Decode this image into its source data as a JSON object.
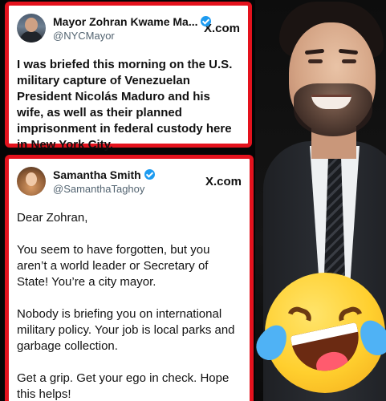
{
  "tweet1": {
    "name": "Mayor Zohran Kwame Ma...",
    "handle": "@NYCMayor",
    "source": "X.com",
    "text": "I was briefed this morning on the U.S. military capture of Venezuelan President Nicolás Maduro and his wife, as well as their planned imprisonment in federal custody here in New York City."
  },
  "tweet2": {
    "name": "Samantha Smith",
    "handle": "@SamanthaTaghoy",
    "source": "X.com",
    "paragraphs": [
      "Dear Zohran,",
      "You seem to have forgotten, but you aren’t a world leader or Secretary of State! You’re a city mayor.",
      "Nobody is briefing you on international military policy. Your job is local parks and garbage collection.",
      "Get a grip. Get your ego in check. Hope this helps!"
    ]
  },
  "colors": {
    "frame_red": "#e4121d",
    "verified_blue": "#1d9bf0",
    "emoji_yellow": "#ffcf2e"
  },
  "icons": [
    "verified-badge-icon",
    "laughing-crying-emoji-icon"
  ]
}
